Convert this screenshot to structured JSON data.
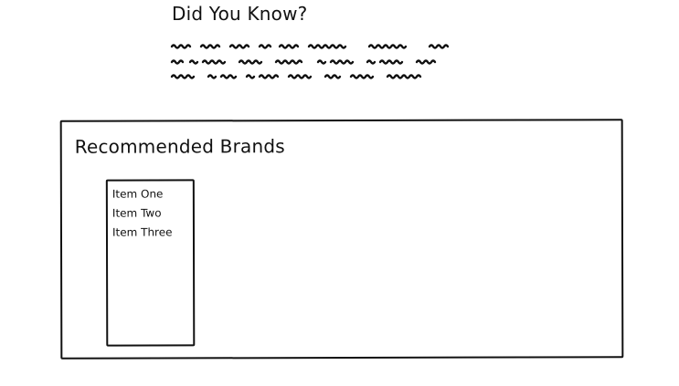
{
  "info": {
    "title": "Did You Know?"
  },
  "brands": {
    "title": "Recommended Brands",
    "items": [
      {
        "label": "Item One"
      },
      {
        "label": "Item Two"
      },
      {
        "label": "Item Three"
      }
    ]
  },
  "colors": {
    "ink": "#111111",
    "background": "#ffffff"
  }
}
